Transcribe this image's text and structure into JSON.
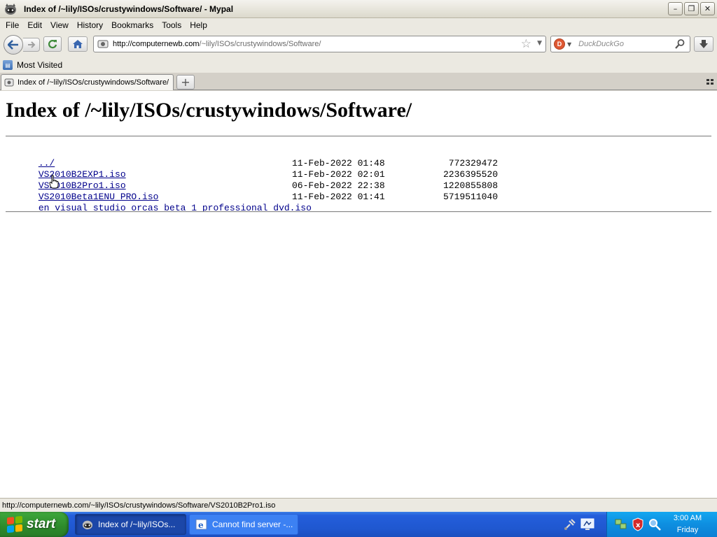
{
  "window": {
    "title": "Index of /~lily/ISOs/crustywindows/Software/ - Mypal",
    "minimize": "–",
    "maximize": "❐",
    "close": "✕"
  },
  "menu": [
    "File",
    "Edit",
    "View",
    "History",
    "Bookmarks",
    "Tools",
    "Help"
  ],
  "nav": {
    "url_host": "http://computernewb.com",
    "url_path": "/~lily/ISOs/crustywindows/Software/",
    "search_placeholder": "DuckDuckGo"
  },
  "bookmarks": {
    "most_visited": "Most Visited"
  },
  "tab": {
    "label": "Index of /~lily/ISOs/crustywindows/Software/"
  },
  "page": {
    "heading": "Index of /~lily/ISOs/crustywindows/Software/",
    "parent_link": "../",
    "files": [
      {
        "name": "VS2010B2EXP1.iso",
        "date": "11-Feb-2022 01:48",
        "size": "772329472"
      },
      {
        "name": "VS2010B2Pro1.iso",
        "date": "11-Feb-2022 02:01",
        "size": "2236395520"
      },
      {
        "name": "VS2010Beta1ENU_PRO.iso",
        "date": "06-Feb-2022 22:38",
        "size": "1220855808"
      },
      {
        "name": "en_visual_studio_orcas_beta_1_professional_dvd.iso",
        "date": "11-Feb-2022 01:41",
        "size": "5719511040"
      }
    ]
  },
  "status": {
    "text": "http://computernewb.com/~lily/ISOs/crustywindows/Software/VS2010B2Pro1.iso"
  },
  "taskbar": {
    "start": "start",
    "tasks": [
      {
        "label": "Index of /~lily/ISOs...",
        "icon": "mypal-icon"
      },
      {
        "label": "Cannot find server -...",
        "icon": "ie-icon"
      }
    ],
    "clock_time": "3:00 AM",
    "clock_day": "Friday"
  },
  "colors": {
    "link": "#00008b",
    "taskbar": "#245edb",
    "start": "#3fa83c",
    "tray": "#0e8ee0"
  }
}
